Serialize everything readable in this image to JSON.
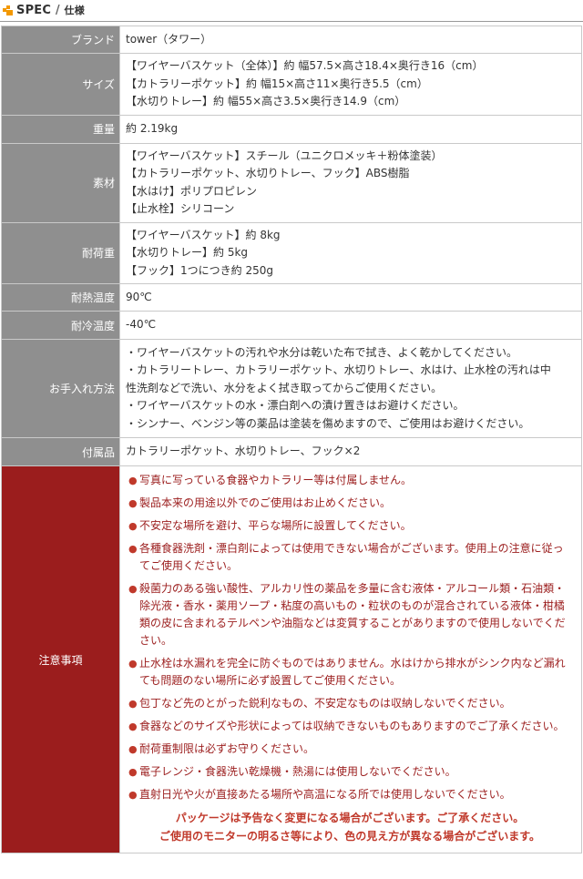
{
  "header": {
    "title_en": "SPEC",
    "separator": "/",
    "title_jp": "仕様"
  },
  "rows": [
    {
      "label": "ブランド",
      "lines": [
        "tower（タワー）"
      ]
    },
    {
      "label": "サイズ",
      "lines": [
        "【ワイヤーバスケット（全体）】約 幅57.5×高さ18.4×奥行き16（cm）",
        "【カトラリーポケット】約 幅15×高さ11×奥行き5.5（cm）",
        "【水切りトレー】約 幅55×高さ3.5×奥行き14.9（cm）"
      ]
    },
    {
      "label": "重量",
      "lines": [
        "約 2.19kg"
      ]
    },
    {
      "label": "素材",
      "lines": [
        "【ワイヤーバスケット】スチール（ユニクロメッキ＋粉体塗装）",
        "【カトラリーポケット、水切りトレー、フック】ABS樹脂",
        "【水はけ】ポリプロピレン",
        "【止水栓】シリコーン"
      ]
    },
    {
      "label": "耐荷重",
      "lines": [
        "【ワイヤーバスケット】約 8kg",
        "【水切りトレー】約 5kg",
        "【フック】1つにつき約 250g"
      ]
    },
    {
      "label": "耐熱温度",
      "lines": [
        "90℃"
      ]
    },
    {
      "label": "耐冷温度",
      "lines": [
        "-40℃"
      ]
    },
    {
      "label": "お手入れ方法",
      "lines": [
        "・ワイヤーバスケットの汚れや水分は乾いた布で拭き、よく乾かしてください。",
        "・カトラリートレー、カトラリーポケット、水切りトレー、水はけ、止水栓の汚れは中",
        "性洗剤などで洗い、水分をよく拭き取ってからご使用ください。",
        "・ワイヤーバスケットの水・漂白剤への漬け置きはお避けください。",
        "・シンナー、ベンジン等の薬品は塗装を傷めますので、ご使用はお避けください。"
      ]
    },
    {
      "label": "付属品",
      "lines": [
        "カトラリーポケット、水切りトレー、フック×2"
      ]
    }
  ],
  "warning": {
    "label": "注意事項",
    "bullet": "●",
    "items": [
      "写真に写っている食器やカトラリー等は付属しません。",
      "製品本来の用途以外でのご使用はお止めください。",
      "不安定な場所を避け、平らな場所に設置してください。",
      "各種食器洗剤・漂白剤によっては使用できない場合がございます。使用上の注意に従ってご使用ください。",
      "殺菌力のある強い酸性、アルカリ性の薬品を多量に含む液体・アルコール類・石油類・除光液・香水・薬用ソープ・粘度の高いもの・粒状のものが混合されている液体・柑橘類の皮に含まれるテルペンや油脂などは変質することがありますので使用しないでください。",
      "止水栓は水漏れを完全に防ぐものではありません。水はけから排水がシンク内など漏れても問題のない場所に必ず設置してご使用ください。",
      "包丁など先のとがった鋭利なもの、不安定なものは収納しないでください。",
      "食器などのサイズや形状によっては収納できないものもありますのでご了承ください。",
      "耐荷重制限は必ずお守りください。",
      "電子レンジ・食器洗い乾燥機・熱湯には使用しないでください。",
      "直射日光や火が直接あたる場所や高温になる所では使用しないでください。"
    ],
    "notice": [
      "パッケージは予告なく変更になる場合がございます。ご了承ください。",
      "ご使用のモニターの明るさ等により、色の見え方が異なる場合がございます。"
    ]
  },
  "colors": {
    "label_bg": "#8f8f8f",
    "warning_bg": "#9b1d1d",
    "warning_text": "#9b1d1d",
    "notice_text": "#c0392b",
    "accent": "#f39800"
  }
}
